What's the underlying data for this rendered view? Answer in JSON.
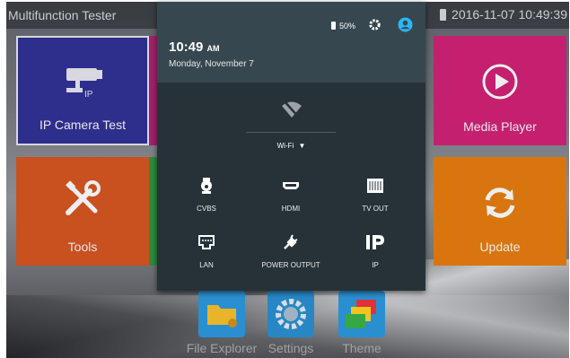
{
  "app": {
    "title": "Multifunction Tester",
    "datetime": "2016-11-07 10:49:39"
  },
  "tiles": {
    "ip_camera": {
      "label": "IP Camera Test",
      "color": "#2e2e8c"
    },
    "tools": {
      "label": "Tools",
      "color": "#c9501f"
    },
    "media_player": {
      "label": "Media Player",
      "color": "#c4206f"
    },
    "update": {
      "label": "Update",
      "color": "#d9750f"
    }
  },
  "dock": [
    {
      "label": "File Explorer",
      "icon": "folder-icon"
    },
    {
      "label": "Settings",
      "icon": "gear-icon"
    },
    {
      "label": "Theme",
      "icon": "theme-icon"
    }
  ],
  "notification_panel": {
    "battery": "50%",
    "time": "10:49",
    "ampm": "AM",
    "date": "Monday, November 7",
    "wifi_label": "Wi-Fi",
    "quick_settings": [
      {
        "label": "CVBS",
        "icon": "camera-icon"
      },
      {
        "label": "HDMI",
        "icon": "hdmi-icon"
      },
      {
        "label": "TV OUT",
        "icon": "tv-out-icon"
      },
      {
        "label": "LAN",
        "icon": "lan-icon"
      },
      {
        "label": "POWER OUTPUT",
        "icon": "power-plug-icon"
      },
      {
        "label": "IP",
        "icon": "ip-icon"
      }
    ],
    "accent_color": "#29b6f6"
  }
}
